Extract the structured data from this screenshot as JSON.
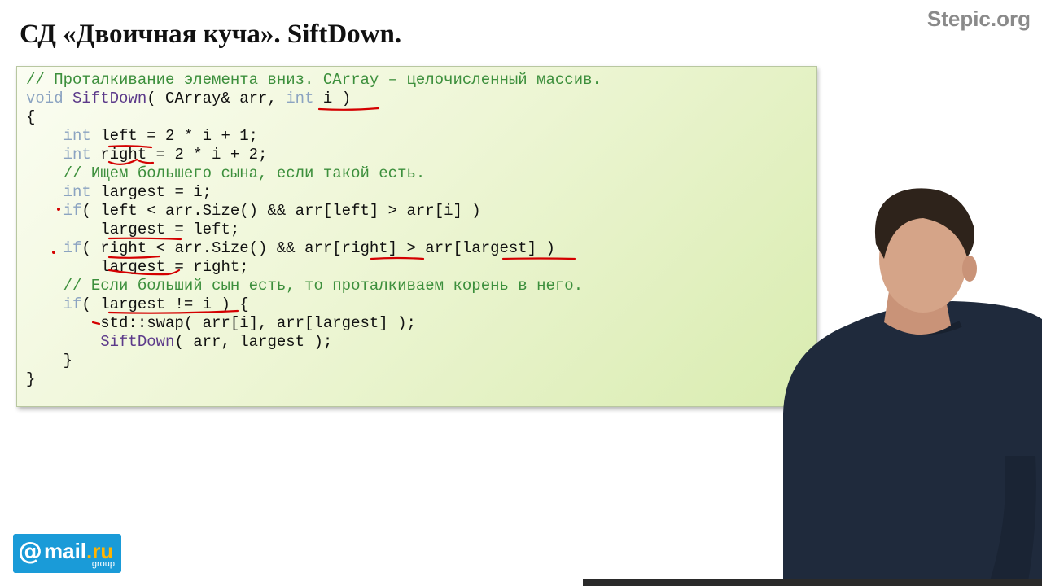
{
  "slide": {
    "title": "СД «Двоичная куча». SiftDown."
  },
  "watermark": "Stepic.org",
  "logo": {
    "at": "@",
    "main": "mail",
    "ru": ".ru",
    "sub": "group"
  },
  "code": {
    "lines": [
      [
        {
          "t": "// Проталкивание элемента вниз. CArray – целочисленный массив.",
          "c": "cm"
        }
      ],
      [
        {
          "t": "void",
          "c": "kw"
        },
        {
          "t": " ",
          "c": "tx"
        },
        {
          "t": "SiftDown",
          "c": "fn"
        },
        {
          "t": "( CArray& arr, ",
          "c": "tx"
        },
        {
          "t": "int",
          "c": "kw"
        },
        {
          "t": " i )",
          "c": "tx"
        }
      ],
      [
        {
          "t": "{",
          "c": "tx"
        }
      ],
      [
        {
          "t": "    ",
          "c": "tx"
        },
        {
          "t": "int",
          "c": "kw"
        },
        {
          "t": " left = 2 * i + 1;",
          "c": "tx"
        }
      ],
      [
        {
          "t": "    ",
          "c": "tx"
        },
        {
          "t": "int",
          "c": "kw"
        },
        {
          "t": " right = 2 * i + 2;",
          "c": "tx"
        }
      ],
      [
        {
          "t": "    // Ищем большего сына, если такой есть.",
          "c": "cm"
        }
      ],
      [
        {
          "t": "    ",
          "c": "tx"
        },
        {
          "t": "int",
          "c": "kw"
        },
        {
          "t": " largest = i;",
          "c": "tx"
        }
      ],
      [
        {
          "t": "    ",
          "c": "tx"
        },
        {
          "t": "if",
          "c": "kw"
        },
        {
          "t": "( left < arr.Size() && arr[left] > arr[i] )",
          "c": "tx"
        }
      ],
      [
        {
          "t": "        largest = left;",
          "c": "tx"
        }
      ],
      [
        {
          "t": "    ",
          "c": "tx"
        },
        {
          "t": "if",
          "c": "kw"
        },
        {
          "t": "( right < arr.Size() && arr[right] > arr[largest] )",
          "c": "tx"
        }
      ],
      [
        {
          "t": "        largest = right;",
          "c": "tx"
        }
      ],
      [
        {
          "t": "    // Если больший сын есть, то проталкиваем корень в него.",
          "c": "cm"
        }
      ],
      [
        {
          "t": "    ",
          "c": "tx"
        },
        {
          "t": "if",
          "c": "kw"
        },
        {
          "t": "( largest != i ) {",
          "c": "tx"
        }
      ],
      [
        {
          "t": "        std::swap( arr[i], arr[largest] );",
          "c": "tx"
        }
      ],
      [
        {
          "t": "        ",
          "c": "tx"
        },
        {
          "t": "SiftDown",
          "c": "fn"
        },
        {
          "t": "( arr, largest );",
          "c": "tx"
        }
      ],
      [
        {
          "t": "    }",
          "c": "tx"
        }
      ],
      [
        {
          "t": "}",
          "c": "tx"
        }
      ]
    ]
  },
  "colors": {
    "keyword": "#8ba3c1",
    "function": "#5c3a8a",
    "comment": "#3c8f3c",
    "ink": "#d40000",
    "logo_bg": "#1a9bd8"
  }
}
